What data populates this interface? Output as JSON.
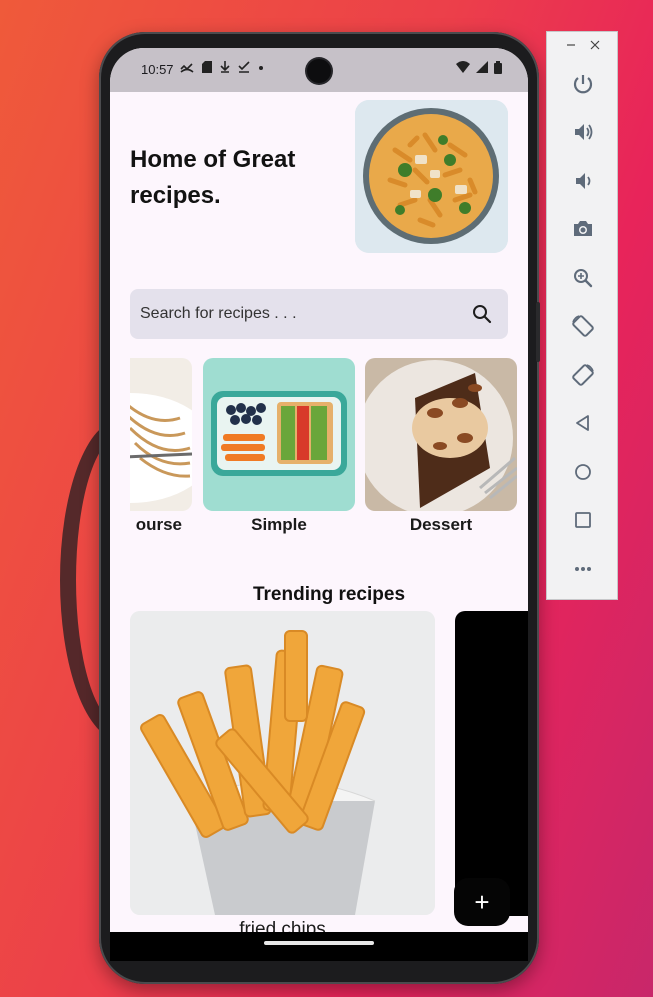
{
  "status_bar": {
    "time": "10:57",
    "icons_left": [
      "missed-call-icon",
      "sd-card-icon",
      "download-icon",
      "check-icon",
      "dot-icon"
    ],
    "icons_right": [
      "wifi-icon",
      "signal-icon",
      "battery-icon"
    ]
  },
  "header": {
    "headline": "Home of Great recipes.",
    "hero_image": "pasta-bowl-image"
  },
  "search": {
    "placeholder": "Search for recipes . . ."
  },
  "categories": [
    {
      "label": "ourse",
      "image": "pasta-image"
    },
    {
      "label": "Simple",
      "image": "lunchbox-image"
    },
    {
      "label": "Dessert",
      "image": "cake-image"
    }
  ],
  "trending": {
    "title": "Trending recipes",
    "items": [
      {
        "caption": "fried chips",
        "image": "fries-image"
      }
    ]
  },
  "fab": {
    "label": "+"
  },
  "emulator_toolbar": {
    "window_controls": [
      "minimize-icon",
      "close-icon"
    ],
    "buttons": [
      "power-icon",
      "volume-up-icon",
      "volume-down-icon",
      "camera-icon",
      "zoom-icon",
      "rotate-left-icon",
      "rotate-right-icon",
      "back-icon",
      "home-icon",
      "overview-icon",
      "more-icon"
    ]
  },
  "colors": {
    "background_start": "#ef5a3a",
    "background_end": "#e8245a",
    "screen_bg": "#fdf6fd",
    "search_bg": "#e4e1ec",
    "status_bar_bg": "#c6c1c8",
    "fab_bg": "#050505"
  }
}
